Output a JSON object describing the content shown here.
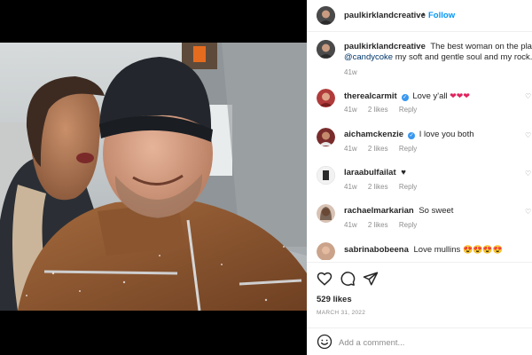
{
  "post": {
    "author": "paulkirklandcreative",
    "follow_label": "Follow",
    "separator": "•"
  },
  "caption": {
    "username": "paulkirklandcreative",
    "text_line1": "The best woman on the planet",
    "mention": "@candycoke",
    "text_line2": "my soft and gentle soul and my rock. I",
    "time": "41w"
  },
  "comments": [
    {
      "username": "therealcarmit",
      "verified": true,
      "text": "Love y'all",
      "emoji": "❤❤❤",
      "time": "41w",
      "likes": "2 likes",
      "reply": "Reply"
    },
    {
      "username": "aichamckenzie",
      "verified": true,
      "text": "I love you both",
      "emoji": "",
      "time": "41w",
      "likes": "2 likes",
      "reply": "Reply"
    },
    {
      "username": "laraabulfailat",
      "verified": false,
      "text": "",
      "emoji": "♥",
      "time": "41w",
      "likes": "2 likes",
      "reply": "Reply"
    },
    {
      "username": "rachaelmarkarian",
      "verified": false,
      "text": "So sweet",
      "emoji": "",
      "time": "41w",
      "likes": "2 likes",
      "reply": "Reply"
    },
    {
      "username": "sabrinabobeena",
      "verified": false,
      "text": "Love mullins",
      "emoji": "😍😍😍😍",
      "time": "",
      "likes": "",
      "reply": ""
    }
  ],
  "actions": {
    "likes": "529 likes",
    "date": "MARCH 31, 2022",
    "add_comment_placeholder": "Add a comment..."
  },
  "icons": {
    "like": "heart-icon",
    "comment": "comment-icon",
    "share": "share-icon",
    "emoji": "smiley-icon"
  },
  "colors": {
    "follow": "#0095f6",
    "verified": "#3897f0",
    "muted": "#8e8e8e"
  }
}
